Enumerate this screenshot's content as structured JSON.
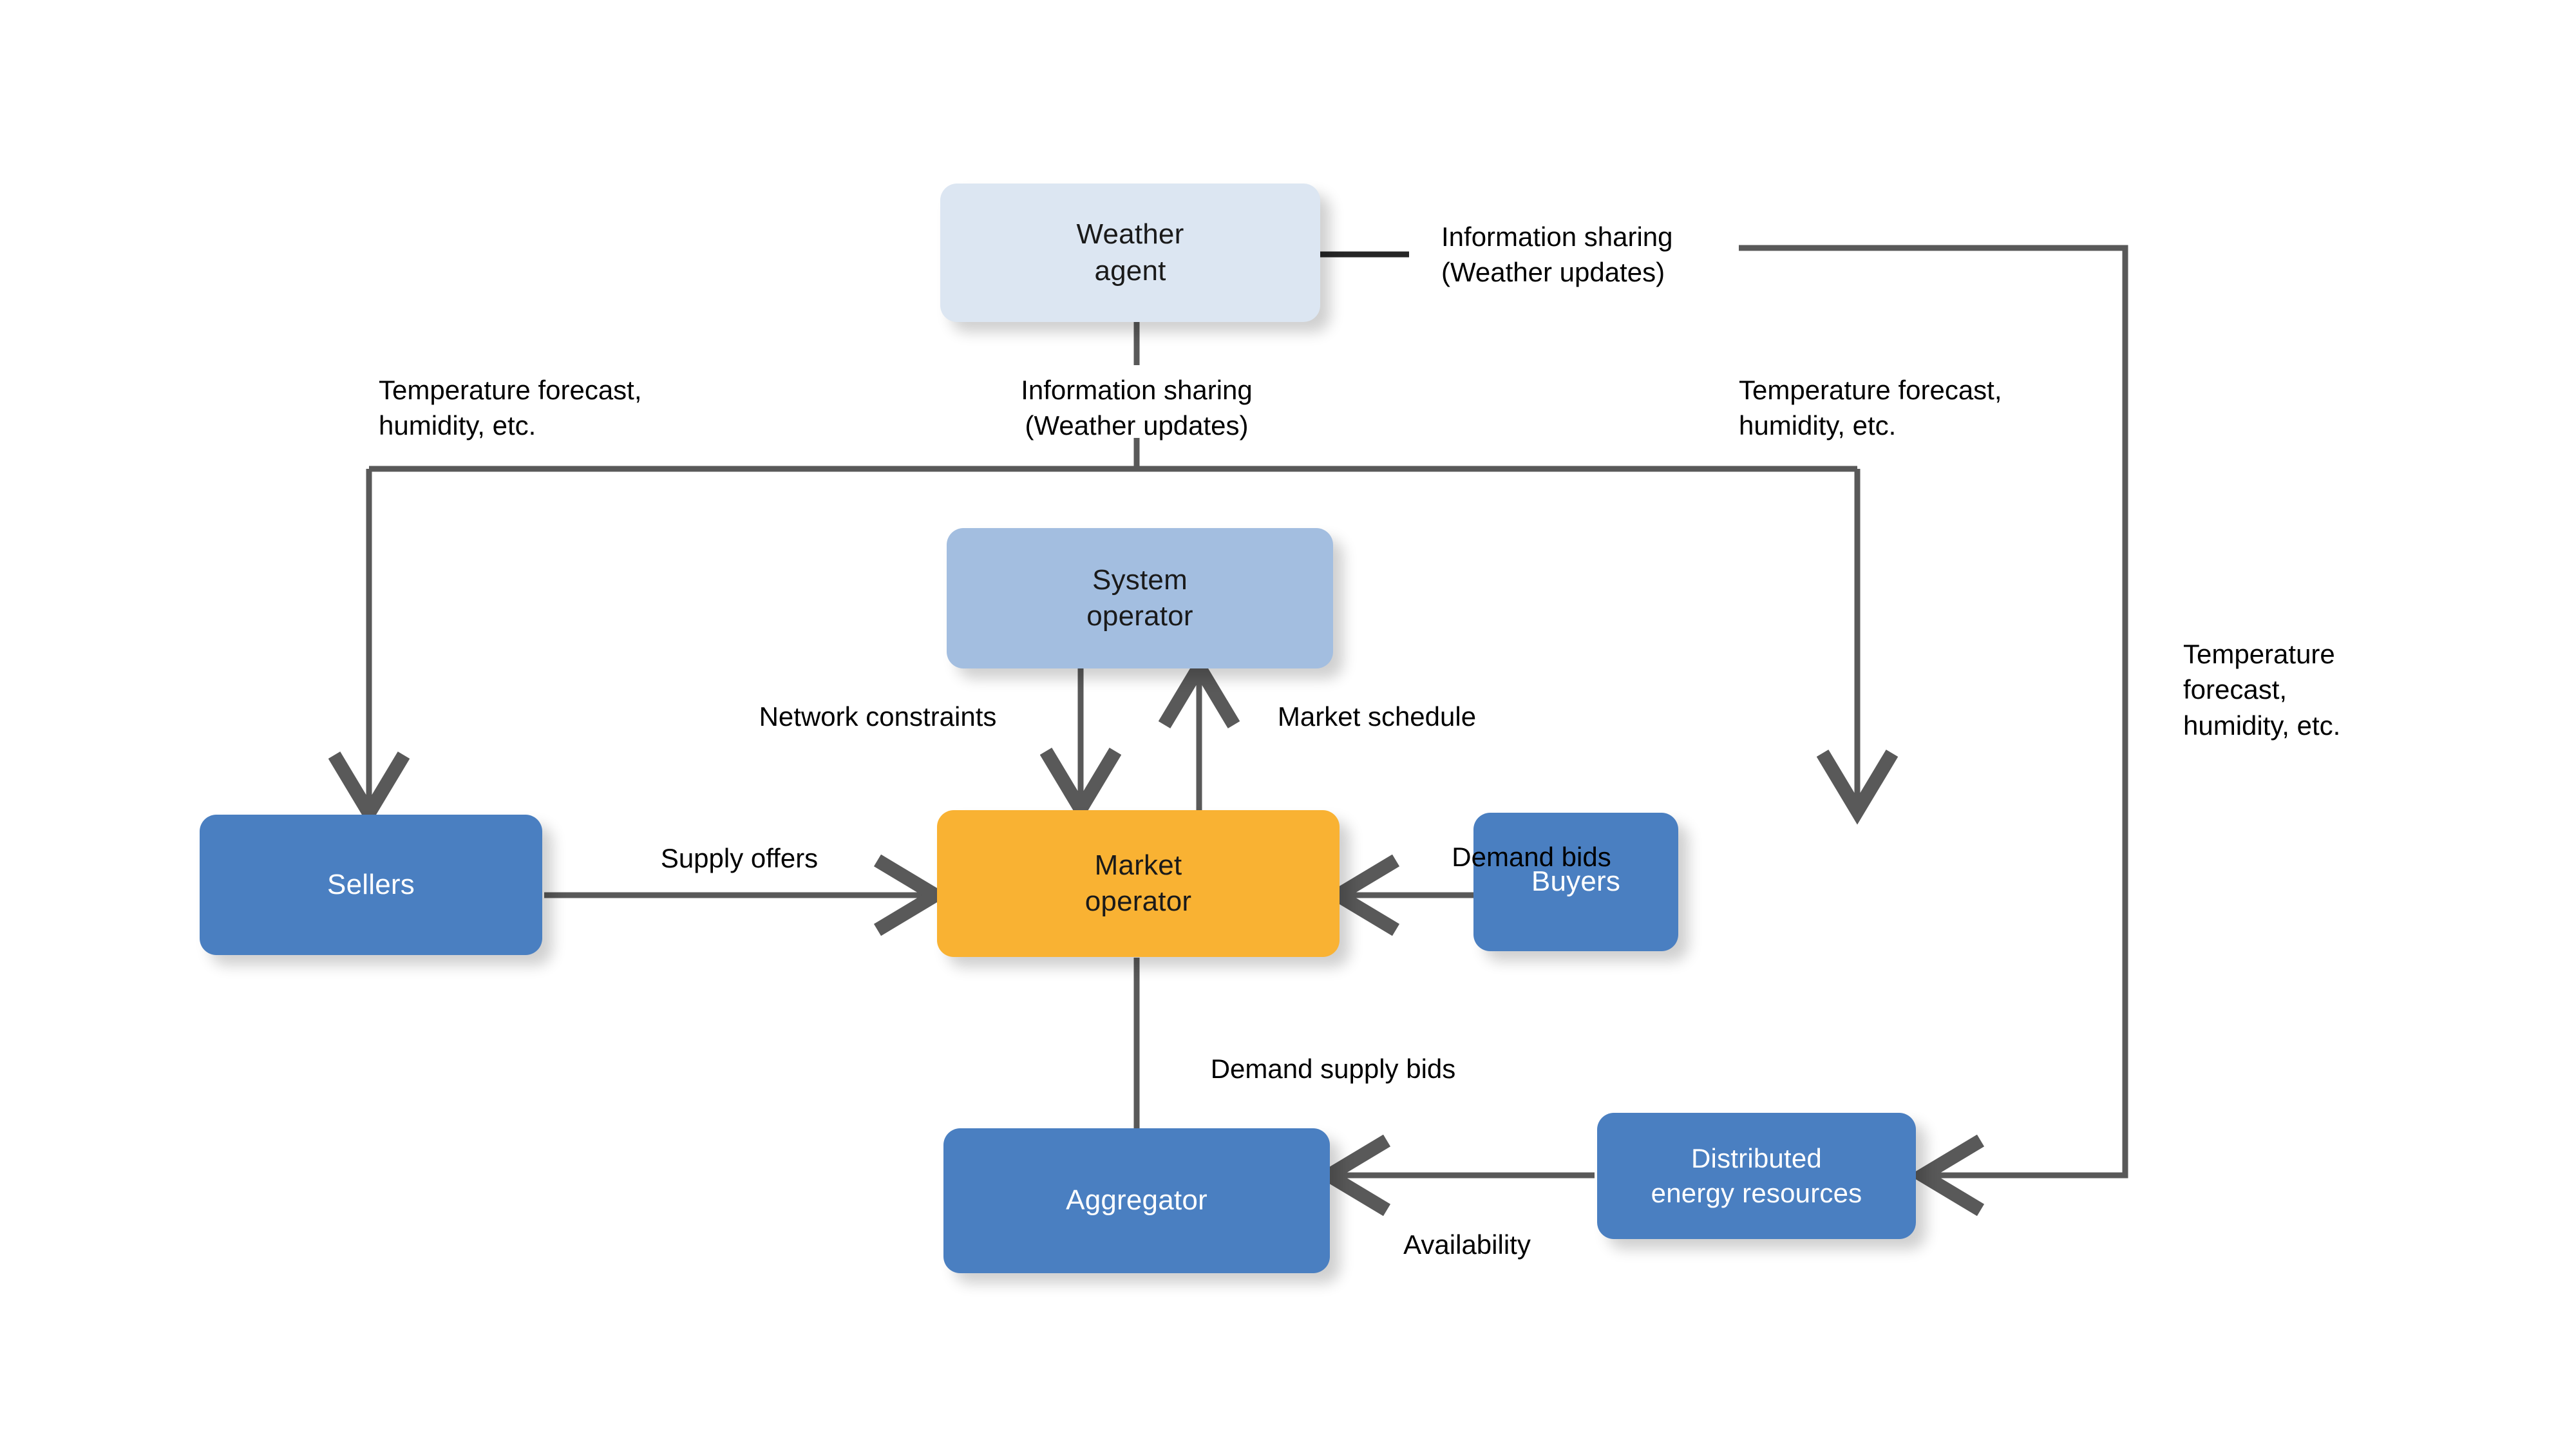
{
  "diagram": {
    "title": "Electricity market multi-agent information flow",
    "colors": {
      "weather_node": "#dce6f2",
      "system_operator_node": "#a3bee0",
      "market_operator_node": "#f9b233",
      "actor_node": "#4a7fc1",
      "connector": "#595959",
      "connector_dark": "#262626",
      "text_dark": "#000000",
      "text_light": "#ffffff",
      "background": "#ffffff"
    },
    "nodes": [
      {
        "id": "weather",
        "label": "Weather\nagent"
      },
      {
        "id": "sysop",
        "label": "System\noperator"
      },
      {
        "id": "market",
        "label": "Market\noperator"
      },
      {
        "id": "sellers",
        "label": "Sellers"
      },
      {
        "id": "buyers",
        "label": "Buyers"
      },
      {
        "id": "aggregator",
        "label": "Aggregator"
      },
      {
        "id": "der",
        "label": "Distributed\nenergy resources"
      }
    ],
    "edge_labels": [
      {
        "id": "info-right",
        "text": "Information sharing\n(Weather updates)"
      },
      {
        "id": "info-down",
        "text": "Information sharing\n(Weather updates)"
      },
      {
        "id": "temp-left",
        "text": "Temperature forecast,\nhumidity, etc."
      },
      {
        "id": "temp-right",
        "text": "Temperature forecast,\nhumidity, etc."
      },
      {
        "id": "temp-far",
        "text": "Temperature\nforecast,\nhumidity, etc."
      },
      {
        "id": "net-constr",
        "text": "Network constraints"
      },
      {
        "id": "mkt-sched",
        "text": "Market schedule"
      },
      {
        "id": "supply",
        "text": "Supply offers"
      },
      {
        "id": "demand",
        "text": "Demand bids"
      },
      {
        "id": "demand-supply",
        "text": "Demand supply bids"
      },
      {
        "id": "availability",
        "text": "Availability"
      }
    ]
  }
}
